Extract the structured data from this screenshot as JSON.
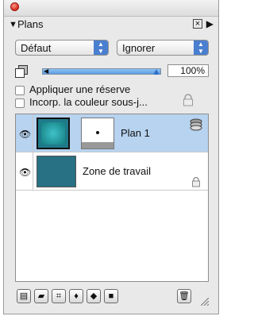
{
  "panel": {
    "title": "Plans"
  },
  "blend_mode": {
    "selected": "Défaut"
  },
  "knockout": {
    "selected": "Ignorer"
  },
  "opacity": {
    "value_text": "100%",
    "level": 1.0
  },
  "options": {
    "reserve_label": "Appliquer une réserve",
    "incorp_label": "Incorp. la couleur sous-j..."
  },
  "layers": [
    {
      "name": "Plan 1",
      "selected": true,
      "visible": true
    },
    {
      "name": "Zone de travail",
      "selected": false,
      "visible": true,
      "locked": true
    }
  ],
  "toolbar_icons": [
    "new-layer-icon",
    "layer-effects-icon",
    "new-group-icon",
    "mask-add-icon",
    "mask-edit-icon",
    "fill-icon",
    "trash-icon"
  ],
  "colors": {
    "accent": "#4a7fd0",
    "selection": "#b7d3f0"
  }
}
